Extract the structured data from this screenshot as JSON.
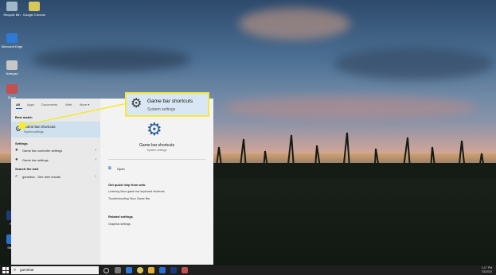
{
  "desktop": {
    "icons": [
      {
        "label": "Recycle Bin",
        "color": "#9fb7c9"
      },
      {
        "label": "Google Chrome",
        "color": "#d8c85a"
      },
      {
        "label": "Microsoft Edge",
        "color": "#2f7ad6"
      },
      {
        "label": "Notepad",
        "color": "#c7c7c7"
      },
      {
        "label": "Zoom",
        "color": "#c44f4f"
      },
      {
        "label": "Steam",
        "color": "#2a6fd1"
      },
      {
        "label": "PS",
        "color": "#1f3a7a"
      }
    ]
  },
  "search_menu": {
    "tabs": [
      "All",
      "Apps",
      "Documents",
      "Web",
      "More"
    ],
    "best_match_header": "Best match",
    "best_match": {
      "title": "Game bar shortcuts",
      "subtitle": "System settings"
    },
    "settings_header": "Settings",
    "settings": [
      "Game bar controller settings",
      "Game bar settings"
    ],
    "web_header": "Search the web",
    "web_result": "gamebar - See web results",
    "detail": {
      "title": "Game bar shortcuts",
      "subtitle": "System settings",
      "open_label": "Open",
      "quick_help_header": "Get quick help from web",
      "quick_help_links": [
        "Learning Xbox game bar keyboard shortcuts",
        "Troubleshooting Xbox Game Bar"
      ],
      "related_header": "Related settings",
      "related_links": [
        "Graphics settings"
      ]
    }
  },
  "callout": {
    "title": "Game bar shortcuts",
    "subtitle": "System settings",
    "accent": "#f4e93b"
  },
  "taskbar": {
    "search_value": "gamebar",
    "time": "1:17 PM",
    "date": "7/3/2020"
  }
}
